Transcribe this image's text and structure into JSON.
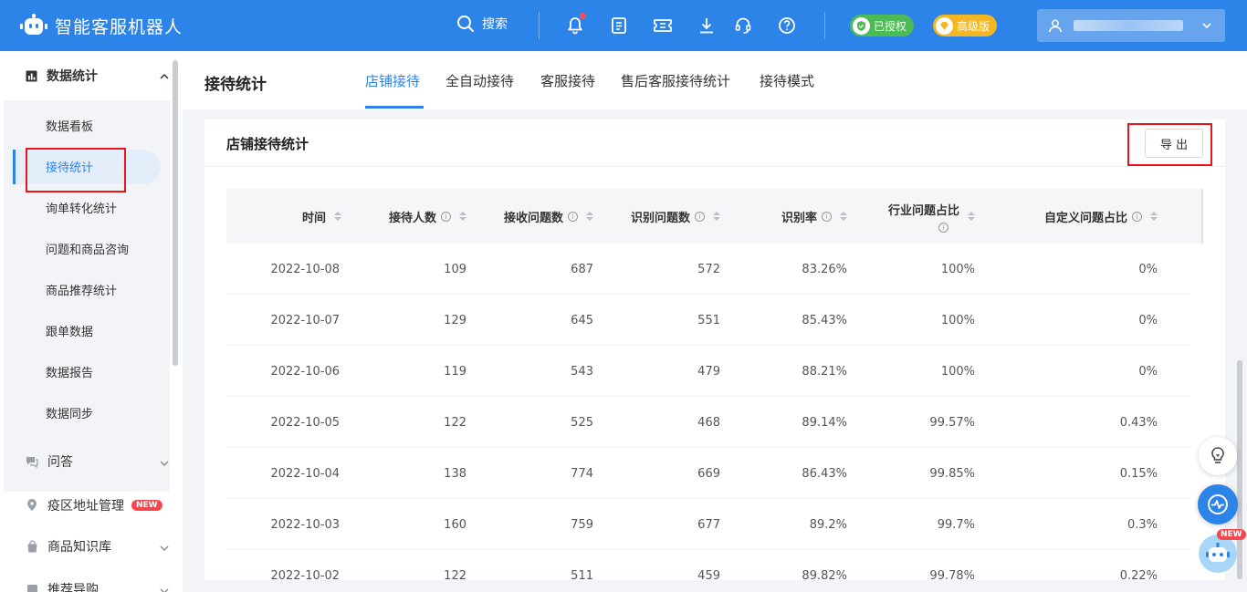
{
  "app": {
    "title": "智能客服机器人",
    "search_label": "搜索",
    "badge_authorized": "已授权",
    "badge_premium": "高级版"
  },
  "icons": {
    "search": "search-icon",
    "bell": "bell-icon",
    "tasks": "checklist-icon",
    "ticket": "ticket-icon",
    "download": "download-icon",
    "support": "headset-icon",
    "help": "help-icon",
    "user": "user-icon"
  },
  "colors": {
    "primary": "#2c83e8",
    "authorized": "#4cbb55",
    "premium": "#f3b723",
    "highlight": "#e8161b"
  },
  "sidebar": {
    "group_title": "数据统计",
    "sub_items": [
      {
        "label": "数据看板"
      },
      {
        "label": "接待统计"
      },
      {
        "label": "询单转化统计"
      },
      {
        "label": "问题和商品咨询"
      },
      {
        "label": "商品推荐统计"
      },
      {
        "label": "跟单数据"
      },
      {
        "label": "数据报告"
      },
      {
        "label": "数据同步"
      }
    ],
    "active_index": 1,
    "nav": [
      {
        "label": "问答"
      },
      {
        "label": "疫区地址管理",
        "badge": "NEW"
      },
      {
        "label": "商品知识库"
      },
      {
        "label": "推荐导购"
      }
    ]
  },
  "header": {
    "page_title": "接待统计",
    "tabs": [
      {
        "label": "店铺接待"
      },
      {
        "label": "全自动接待"
      },
      {
        "label": "客服接待"
      },
      {
        "label": "售后客服接待统计"
      },
      {
        "label": "接待模式"
      }
    ],
    "active_tab": 0
  },
  "card": {
    "title": "店铺接待统计",
    "export_label": "导出"
  },
  "table": {
    "columns": [
      "时间",
      "接待人数",
      "接收问题数",
      "识别问题数",
      "识别率",
      "行业问题占比",
      "自定义问题占比"
    ],
    "rows": [
      [
        "2022-10-08",
        "109",
        "687",
        "572",
        "83.26%",
        "100%",
        "0%"
      ],
      [
        "2022-10-07",
        "129",
        "645",
        "551",
        "85.43%",
        "100%",
        "0%"
      ],
      [
        "2022-10-06",
        "119",
        "543",
        "479",
        "88.21%",
        "100%",
        "0%"
      ],
      [
        "2022-10-05",
        "122",
        "525",
        "468",
        "89.14%",
        "99.57%",
        "0.43%"
      ],
      [
        "2022-10-04",
        "138",
        "774",
        "669",
        "86.43%",
        "99.85%",
        "0.15%"
      ],
      [
        "2022-10-03",
        "160",
        "759",
        "677",
        "89.2%",
        "99.7%",
        "0.3%"
      ],
      [
        "2022-10-02",
        "122",
        "511",
        "459",
        "89.82%",
        "99.78%",
        "0.22%"
      ]
    ]
  },
  "floating": {
    "new_badge": "NEW"
  }
}
